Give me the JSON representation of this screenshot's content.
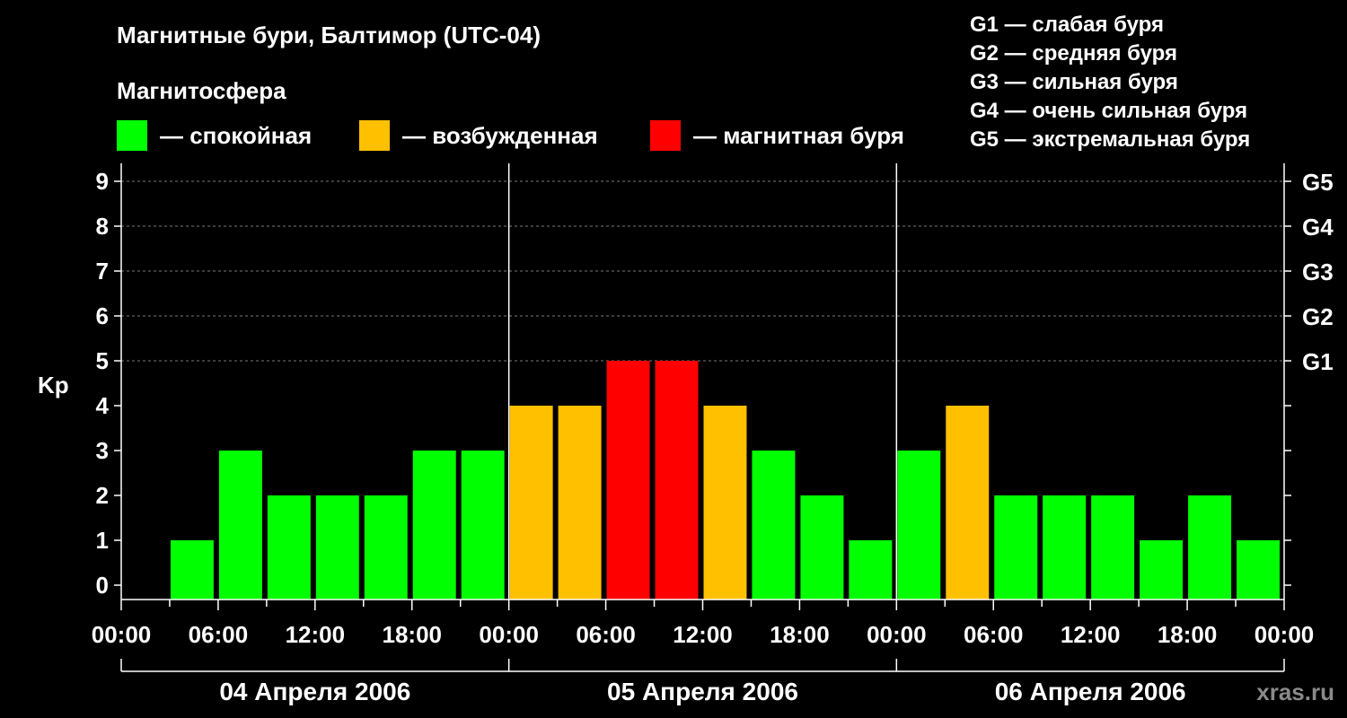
{
  "title": "Магнитные бури, Балтимор (UTC-04)",
  "legend": {
    "heading": "Магнитосфера",
    "items": [
      {
        "label": "— спокойная",
        "color": "#00ff00"
      },
      {
        "label": "— возбужденная",
        "color": "#ffc000"
      },
      {
        "label": "— магнитная буря",
        "color": "#ff0000"
      }
    ]
  },
  "g_levels": [
    "G1 — слабая буря",
    "G2 — средняя буря",
    "G3 — сильная буря",
    "G4 — очень сильная буря",
    "G5 — экстремальная буря"
  ],
  "watermark": "xras.ru",
  "colors": {
    "quiet": "#00ff00",
    "active": "#ffc000",
    "storm": "#ff0000",
    "background": "#000000"
  },
  "chart_data": {
    "type": "bar",
    "ylabel": "Kp",
    "ylim": [
      0,
      9
    ],
    "yticks": [
      "0",
      "1",
      "2",
      "3",
      "4",
      "5",
      "6",
      "7",
      "8",
      "9"
    ],
    "right_ticks": [
      {
        "kp": 5,
        "label": "G1"
      },
      {
        "kp": 6,
        "label": "G2"
      },
      {
        "kp": 7,
        "label": "G3"
      },
      {
        "kp": 8,
        "label": "G4"
      },
      {
        "kp": 9,
        "label": "G5"
      }
    ],
    "xtick_labels": [
      "00:00",
      "06:00",
      "12:00",
      "18:00",
      "00:00",
      "06:00",
      "12:00",
      "18:00",
      "00:00",
      "06:00",
      "12:00",
      "18:00",
      "00:00"
    ],
    "days": [
      "04 Апреля 2006",
      "05 Апреля 2006",
      "06 Апреля 2006"
    ],
    "grid": "dashed horizontal lines at Kp 5-9",
    "values": [
      1,
      3,
      2,
      2,
      2,
      3,
      3,
      4,
      4,
      5,
      5,
      4,
      3,
      2,
      1,
      3,
      4,
      2,
      2,
      2,
      1,
      2,
      1
    ],
    "levels": [
      "quiet",
      "quiet",
      "quiet",
      "quiet",
      "quiet",
      "quiet",
      "quiet",
      "active",
      "active",
      "storm",
      "storm",
      "active",
      "quiet",
      "quiet",
      "quiet",
      "quiet",
      "active",
      "quiet",
      "quiet",
      "quiet",
      "quiet",
      "quiet",
      "quiet"
    ]
  }
}
